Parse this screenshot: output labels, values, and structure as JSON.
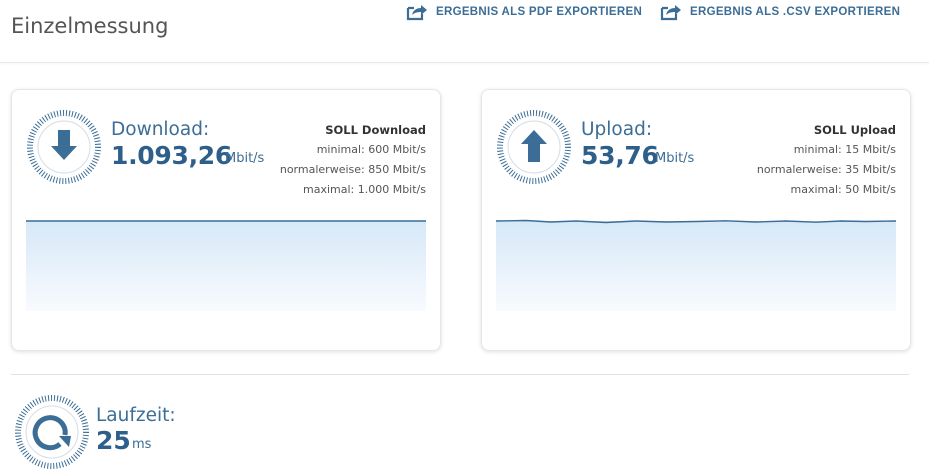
{
  "header": {
    "title": "Einzelmessung",
    "export_pdf_label": "ERGEBNIS ALS PDF EXPORTIEREN",
    "export_csv_label": "ERGEBNIS ALS .CSV EXPORTIEREN"
  },
  "download": {
    "label": "Download:",
    "value": "1.093,26",
    "unit": "Mbit/s",
    "soll_title": "SOLL Download",
    "soll_min": "minimal: 600 Mbit/s",
    "soll_normal": "normalerweise: 850 Mbit/s",
    "soll_max": "maximal: 1.000 Mbit/s"
  },
  "upload": {
    "label": "Upload:",
    "value": "53,76",
    "unit": "Mbit/s",
    "soll_title": "SOLL Upload",
    "soll_min": "minimal: 15 Mbit/s",
    "soll_normal": "normalerweise: 35 Mbit/s",
    "soll_max": "maximal: 50 Mbit/s"
  },
  "latency": {
    "label": "Laufzeit:",
    "value": "25",
    "unit": "ms"
  },
  "icons": {
    "export": "export-icon",
    "download": "arrow-down-icon",
    "upload": "arrow-up-icon",
    "latency": "refresh-icon"
  },
  "colors": {
    "accent": "#3b6d96",
    "accent_dark": "#2e5f8a",
    "graph_fill": "#d6e8f7"
  }
}
